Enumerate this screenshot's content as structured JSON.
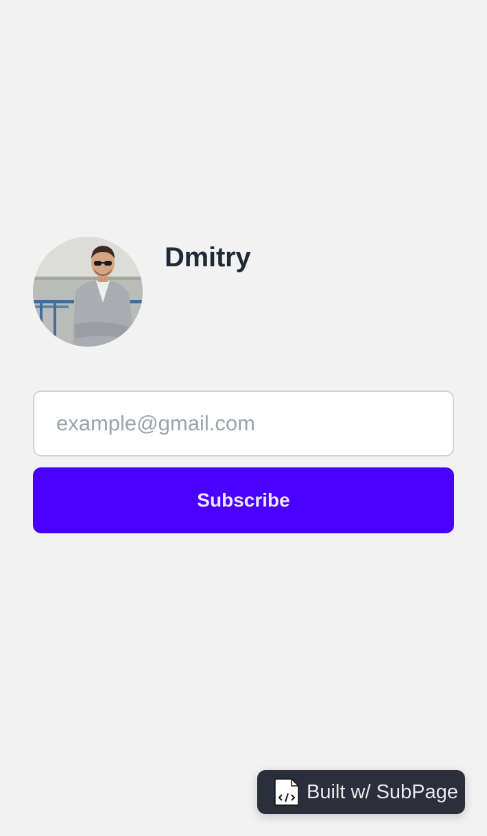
{
  "profile": {
    "name": "Dmitry"
  },
  "subscribe_form": {
    "email_placeholder": "example@gmail.com",
    "email_value": "",
    "button_label": "Subscribe"
  },
  "badge": {
    "label": "Built w/ SubPage",
    "icon": "code-file-icon"
  },
  "colors": {
    "background": "#f2f2f2",
    "accent": "#4a00ff",
    "name_text": "#1f2937",
    "badge_background": "#2a2f3b"
  }
}
